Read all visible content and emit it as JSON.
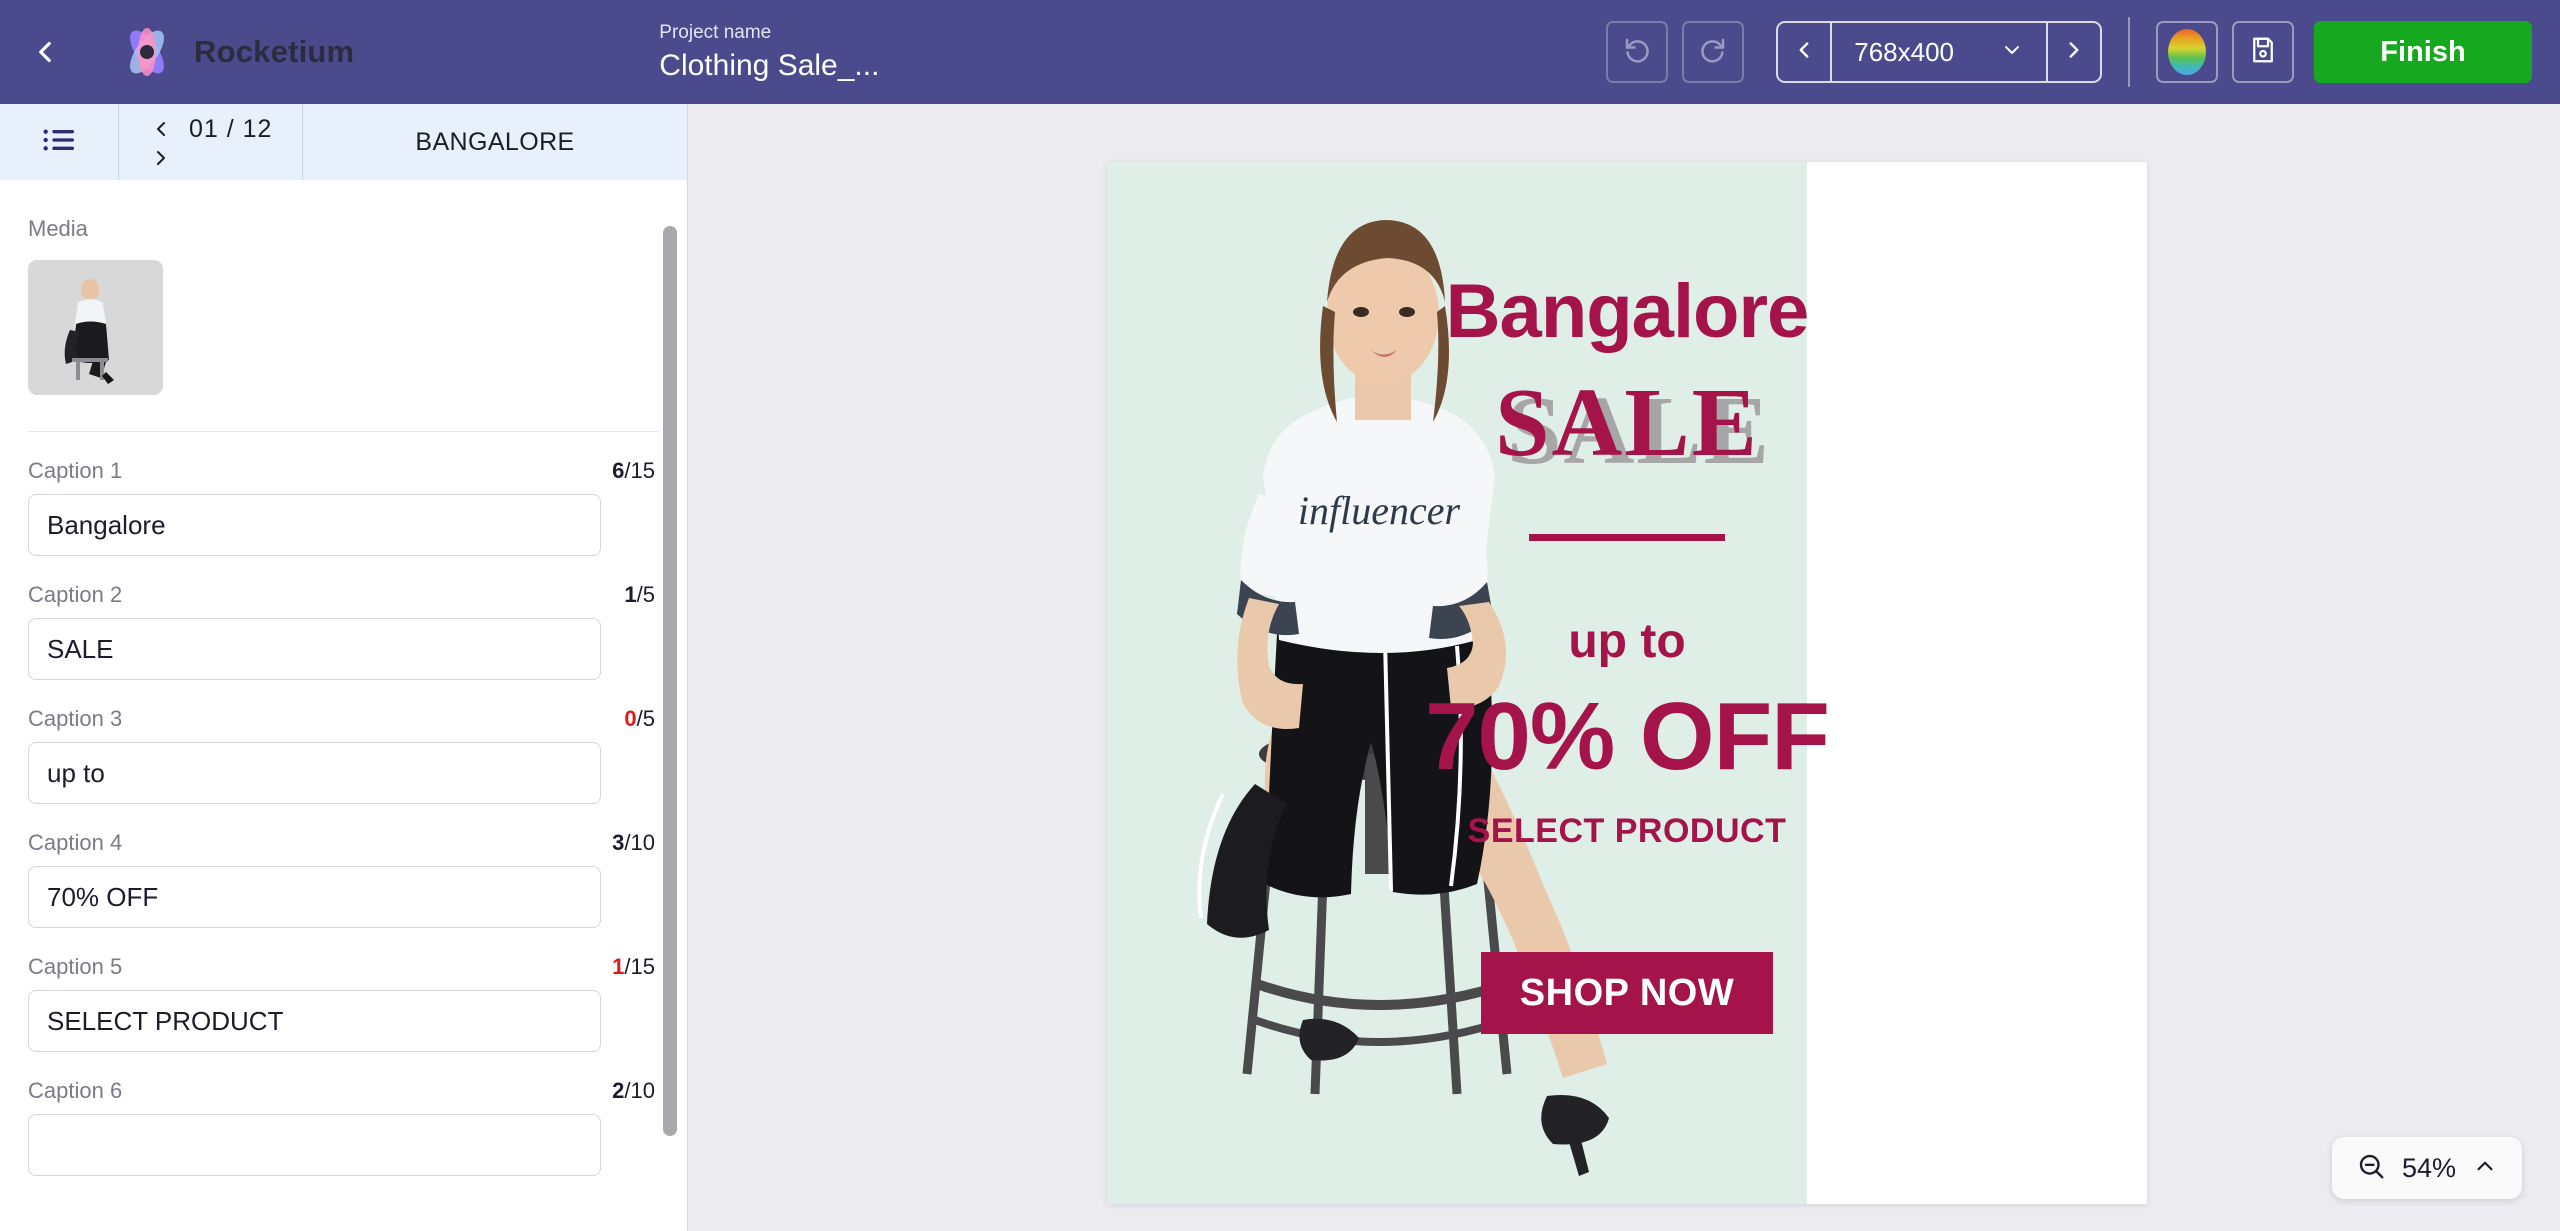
{
  "topbar": {
    "back_icon": "chevron-left-icon",
    "brand_name": "Rocketium",
    "project_label": "Project name",
    "project_title": "Clothing Sale_...",
    "undo_icon": "undo-icon",
    "redo_icon": "redo-icon",
    "dimension_prev_icon": "chevron-left-icon",
    "dimension_next_icon": "chevron-right-icon",
    "dimension_value": "768x400",
    "dimension_caret_icon": "chevron-down-icon",
    "palette_icon": "color-palette-icon",
    "save_icon": "save-disk-icon",
    "finish_label": "Finish"
  },
  "panel": {
    "list_icon": "list-view-icon",
    "pager_prev_icon": "chevron-left-icon",
    "pager_next_icon": "chevron-right-icon",
    "pager_text": "01 / 12",
    "slide_name": "BANGALORE",
    "media_label": "Media",
    "media_thumb_name": "media-thumbnail",
    "captions": [
      {
        "label": "Caption 1",
        "value": "Bangalore",
        "count": "6",
        "max": "/15",
        "over": false
      },
      {
        "label": "Caption 2",
        "value": "SALE",
        "count": "1",
        "max": "/5",
        "over": false
      },
      {
        "label": "Caption 3",
        "value": "up to",
        "count": "0",
        "max": "/5",
        "over": true
      },
      {
        "label": "Caption 4",
        "value": "70% OFF",
        "count": "3",
        "max": "/10",
        "over": false
      },
      {
        "label": "Caption 5",
        "value": "SELECT PRODUCT",
        "count": "1",
        "max": "/15",
        "over": true
      },
      {
        "label": "Caption 6",
        "value": "",
        "count": "2",
        "max": "/10",
        "over": false
      }
    ]
  },
  "artboard": {
    "title": "Bangalore",
    "sale": "SALE",
    "up_to": "up to",
    "offer": "70% OFF",
    "subtitle": "SELECT PRODUCT",
    "cta": "SHOP NOW",
    "shirt_text": "influencer",
    "colors": {
      "brand_maroon": "#a4144b",
      "panel_mint": "#dfeee7",
      "shadow_grey": "#a6a6a6"
    }
  },
  "zoom": {
    "minus_icon": "zoom-out-icon",
    "value": "54%",
    "caret_icon": "chevron-up-icon"
  }
}
